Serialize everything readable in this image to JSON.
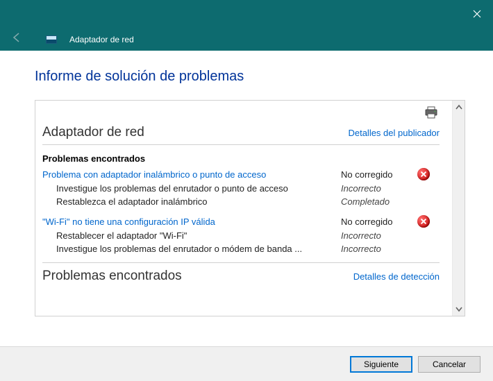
{
  "titlebar": {
    "window_title": "Adaptador de red"
  },
  "page": {
    "headline": "Informe de solución de problemas",
    "section1_title": "Adaptador de red",
    "publisher_link": "Detalles del publicador",
    "problems_found": "Problemas encontrados",
    "section2_title": "Problemas encontrados",
    "detection_link": "Detalles de detección"
  },
  "issues": [
    {
      "title": "Problema con adaptador inalámbrico o punto de acceso",
      "status": "No corregido",
      "steps": [
        {
          "text": "Investigue los problemas del enrutador o punto de acceso",
          "status": "Incorrecto"
        },
        {
          "text": "Restablezca el adaptador inalámbrico",
          "status": "Completado"
        }
      ]
    },
    {
      "title": "\"Wi-Fi\" no tiene una configuración IP válida",
      "status": "No corregido",
      "steps": [
        {
          "text": "Restablecer el adaptador \"Wi-Fi\"",
          "status": "Incorrecto"
        },
        {
          "text": "Investigue los problemas del enrutador o módem de banda ...",
          "status": "Incorrecto"
        }
      ]
    }
  ],
  "buttons": {
    "next": "Siguiente",
    "cancel": "Cancelar"
  }
}
